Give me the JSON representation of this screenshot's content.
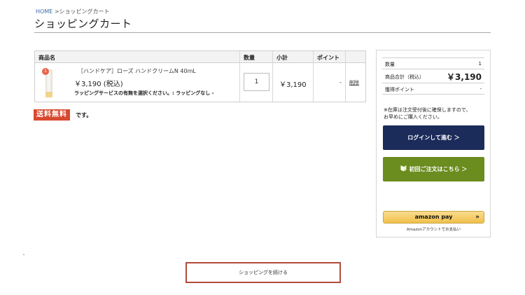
{
  "breadcrumb": {
    "home": "HOME",
    "separator": " >",
    "current": "ショッピングカート"
  },
  "page": {
    "title": "ショッピングカート"
  },
  "cart": {
    "headers": {
      "product": "商品名",
      "quantity": "数量",
      "subtotal": "小計",
      "points": "ポイント"
    },
    "item": {
      "badge": "1",
      "name": "［ハンドケア］ローズ ハンドクリームN 40mL",
      "price": "￥3,190 (税込)",
      "wrapping": "ラッピングサービスの有無を選択ください。: ラッピングなし -",
      "quantity": "1",
      "subtotal": "￥3,190",
      "points": "-",
      "delete_label": "削除"
    },
    "free_shipping": {
      "badge": "送料無料",
      "suffix": "です。"
    }
  },
  "summary": {
    "quantity_label": "数量",
    "quantity_value": "1",
    "total_label": "商品合計（税込）",
    "total_value": "￥3,190",
    "points_label": "獲得ポイント",
    "points_value": "-",
    "note_line1": "※在庫は注文受付後に確保しますので、",
    "note_line2": "お早めにご購入ください。",
    "login_button": "ログインして進む ＞",
    "first_order_button": "初回ご注文はこちら ＞",
    "amazon_pay_label": "amazon pay",
    "amazon_pay_arrows": "»",
    "amazon_note": "Amazonアカウントでお支払い"
  },
  "continue_button": "ショッピングを続ける",
  "colors": {
    "accent_red": "#d8492f",
    "login_navy": "#1c2c5a",
    "first_order_green": "#6b8c1f",
    "amazon_gold": "#f0c14b"
  }
}
